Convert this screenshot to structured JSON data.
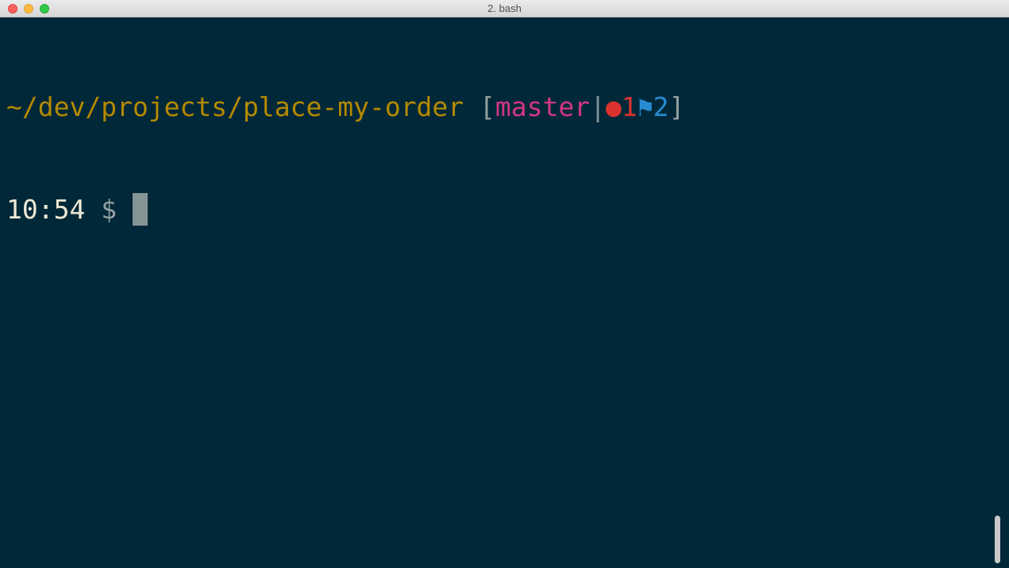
{
  "window": {
    "title": "2. bash"
  },
  "prompt": {
    "path": "~/dev/projects/place-my-order",
    "open_bracket": "[",
    "branch": "master",
    "separator": "|",
    "dirty_marker": "●1",
    "flag_marker": "⚑2",
    "close_bracket": "]",
    "time": "10:54",
    "symbol": "$"
  },
  "colors": {
    "background": "#002838",
    "path": "#b58900",
    "branch": "#d33682",
    "dirty": "#dc322f",
    "flag": "#268bd2",
    "text": "#eee8d5"
  }
}
